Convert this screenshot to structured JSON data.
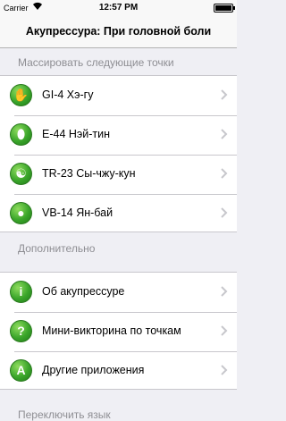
{
  "status_bar": {
    "carrier": "Carrier",
    "time": "12:57 PM",
    "wifi_icon": "wifi-icon",
    "battery_level": 1.0
  },
  "nav": {
    "title": "Акупрессура: При головной боли"
  },
  "sections": {
    "points": {
      "header": "Массировать следующие точки",
      "items": [
        {
          "label": "GI-4 Хэ-гу",
          "icon": "hand-icon",
          "glyph": "✋"
        },
        {
          "label": "E-44 Нэй-тин",
          "icon": "foot-icon",
          "glyph": "⬮"
        },
        {
          "label": "TR-23 Сы-чжу-кун",
          "icon": "yin-yang-icon",
          "glyph": "☯"
        },
        {
          "label": "VB-14 Ян-бай",
          "icon": "head-icon",
          "glyph": "●"
        }
      ]
    },
    "extra": {
      "header": "Дополнительно",
      "items": [
        {
          "label": "Об акупрессуре",
          "icon": "info-icon",
          "glyph": "i"
        },
        {
          "label": "Мини-викторина по точкам",
          "icon": "question-icon",
          "glyph": "?"
        },
        {
          "label": "Другие приложения",
          "icon": "apps-icon",
          "glyph": "A"
        }
      ]
    },
    "language": {
      "header": "Переключить язык"
    }
  },
  "colors": {
    "icon_green": "#3aa52a",
    "section_text": "#8e8e93",
    "chevron": "#c7c7cc"
  }
}
